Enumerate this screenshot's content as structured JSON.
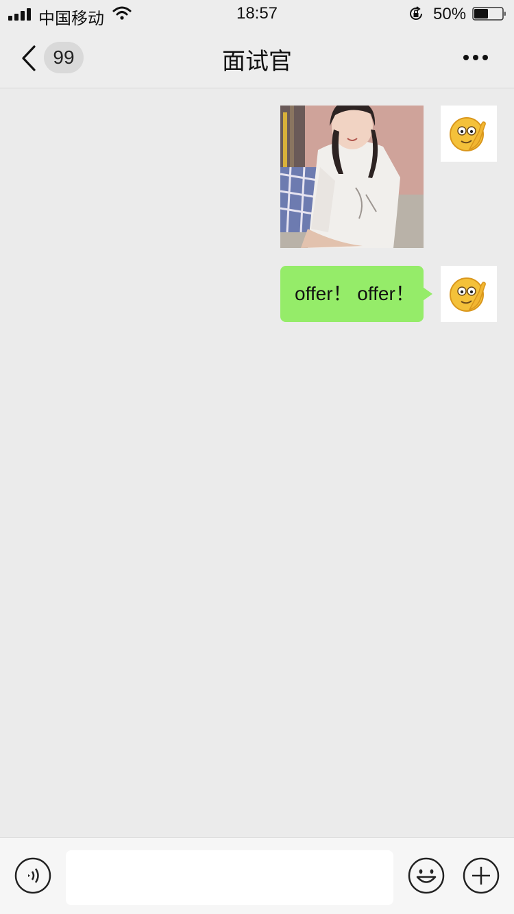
{
  "status_bar": {
    "carrier": "中国移动",
    "time": "18:57",
    "battery_percent": "50%",
    "battery_level": 0.5,
    "icons": [
      "signal-icon",
      "wifi-icon",
      "rotation-lock-icon",
      "battery-icon"
    ]
  },
  "nav": {
    "unread_count": "99",
    "title": "面试官",
    "icons": [
      "back-chevron-icon",
      "more-dots-icon"
    ]
  },
  "messages": [
    {
      "type": "image",
      "sender": "me",
      "content": "photo"
    },
    {
      "type": "text",
      "sender": "me",
      "text": "offer！ offer！"
    }
  ],
  "input_bar": {
    "placeholder": "",
    "icons": [
      "voice-icon",
      "emoji-icon",
      "plus-icon"
    ]
  },
  "colors": {
    "background": "#ebebeb",
    "bar_background": "#ededed",
    "bubble_green": "#95ec69",
    "badge_gray": "#d9d9d9"
  }
}
